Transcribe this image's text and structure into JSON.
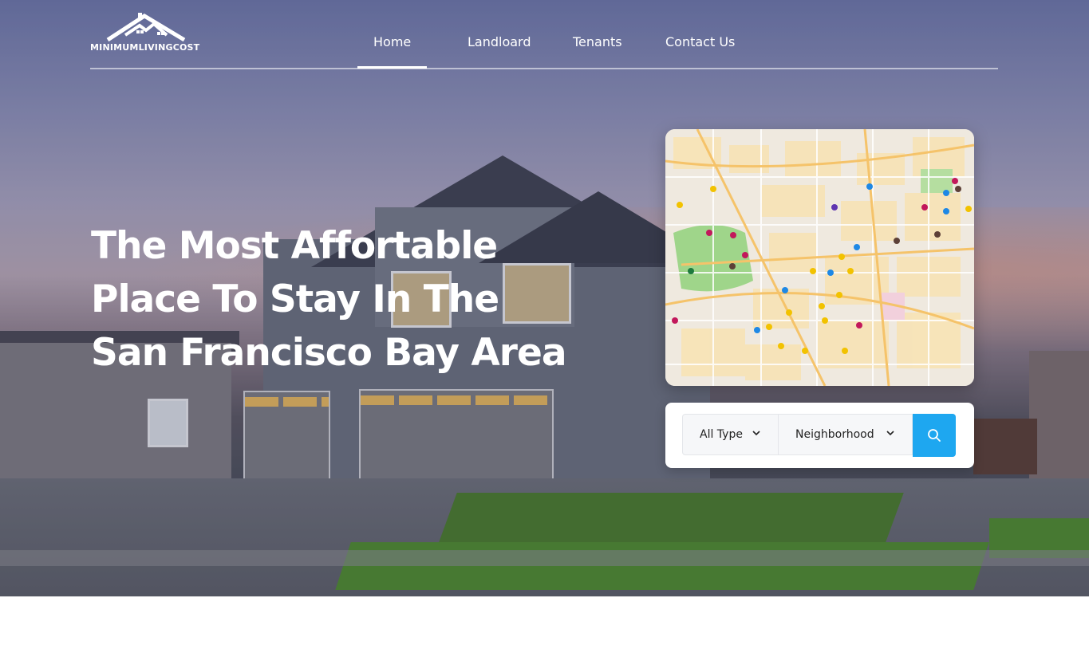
{
  "brand": {
    "logo_text": "MINIMUMLIVINGCOST"
  },
  "nav": {
    "items": [
      {
        "label": "Home",
        "active": true
      },
      {
        "label": "Landloard",
        "active": false
      },
      {
        "label": "Tenants",
        "active": false
      },
      {
        "label": "Contact Us",
        "active": false
      }
    ]
  },
  "hero": {
    "headline_lines": [
      "The Most Affortable",
      "Place To Stay In The",
      "San Francisco Bay Area"
    ]
  },
  "search": {
    "type_select": {
      "value": "All Type"
    },
    "neighborhood_select": {
      "value": "Neighborhood"
    },
    "button_icon": "search-icon",
    "accent_color": "#1ea7f0"
  },
  "icons": {
    "chevron": "chevron-down-icon",
    "search": "search-icon",
    "logo": "house-roof-logo-icon"
  }
}
